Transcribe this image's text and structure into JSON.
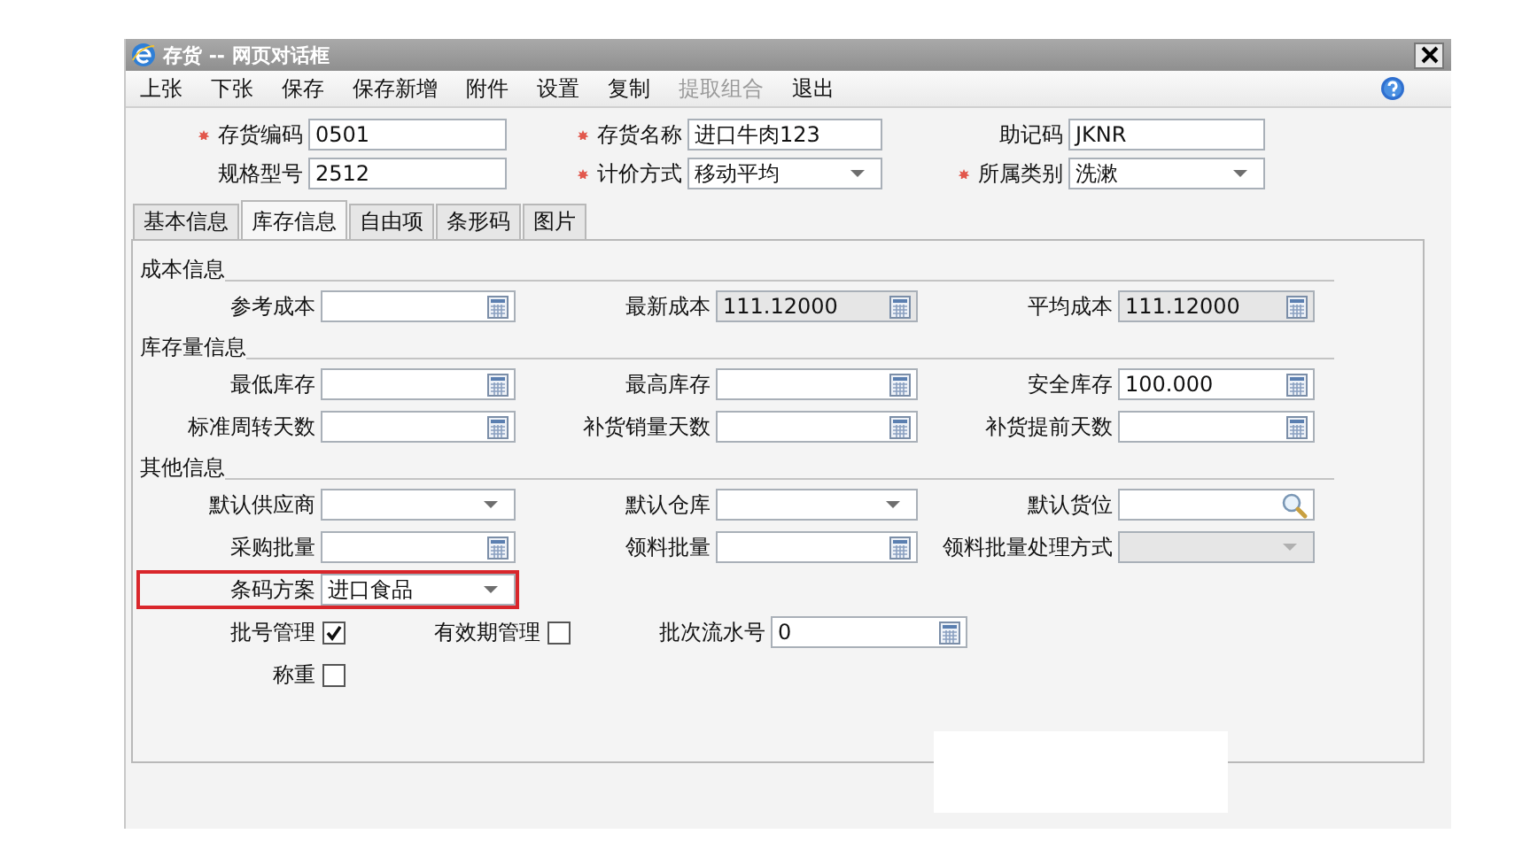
{
  "window": {
    "title": "存货 -- 网页对话框"
  },
  "toolbar": [
    {
      "label": "上张",
      "disabled": false
    },
    {
      "label": "下张",
      "disabled": false
    },
    {
      "label": "保存",
      "disabled": false
    },
    {
      "label": "保存新增",
      "disabled": false
    },
    {
      "label": "附件",
      "disabled": false
    },
    {
      "label": "设置",
      "disabled": false
    },
    {
      "label": "复制",
      "disabled": false
    },
    {
      "label": "提取组合",
      "disabled": true
    },
    {
      "label": "退出",
      "disabled": false
    }
  ],
  "header_rows": [
    {
      "fields": [
        {
          "label": "存货编码",
          "value": "0501",
          "required": true,
          "kind": "text"
        },
        {
          "label": "存货名称",
          "value": "进口牛肉123",
          "required": true,
          "kind": "text"
        },
        {
          "label": "助记码",
          "value": "JKNR",
          "required": false,
          "kind": "text"
        }
      ]
    },
    {
      "fields": [
        {
          "label": "规格型号",
          "value": "2512",
          "required": false,
          "kind": "text"
        },
        {
          "label": "计价方式",
          "value": "移动平均",
          "required": true,
          "kind": "select"
        },
        {
          "label": "所属类别",
          "value": "洗漱",
          "required": true,
          "kind": "select"
        }
      ]
    }
  ],
  "tabs": [
    {
      "label": "基本信息",
      "selected": false
    },
    {
      "label": "库存信息",
      "selected": true
    },
    {
      "label": "自由项",
      "selected": false
    },
    {
      "label": "条形码",
      "selected": false
    },
    {
      "label": "图片",
      "selected": false
    }
  ],
  "sections": [
    {
      "title": "成本信息",
      "rows": [
        {
          "fields": [
            {
              "label": "参考成本",
              "kind": "number",
              "disabled": false
            },
            {
              "label": "最新成本",
              "value": "111.12000",
              "kind": "number",
              "disabled": true
            },
            {
              "label": "平均成本",
              "value": "111.12000",
              "kind": "number",
              "disabled": true
            }
          ]
        }
      ]
    },
    {
      "title": "库存量信息",
      "rows": [
        {
          "fields": [
            {
              "label": "最低库存",
              "kind": "number",
              "disabled": false
            },
            {
              "label": "最高库存",
              "kind": "number",
              "disabled": false
            },
            {
              "label": "安全库存",
              "value": "100.000",
              "kind": "number",
              "disabled": false
            }
          ]
        },
        {
          "fields": [
            {
              "label": "标准周转天数",
              "kind": "number",
              "disabled": false
            },
            {
              "label": "补货销量天数",
              "kind": "number",
              "disabled": false
            },
            {
              "label": "补货提前天数",
              "kind": "number",
              "disabled": false
            }
          ]
        }
      ]
    },
    {
      "title": "其他信息",
      "rows": [
        {
          "fields": [
            {
              "label": "默认供应商",
              "kind": "select",
              "disabled": false
            },
            {
              "label": "默认仓库",
              "kind": "select",
              "disabled": false
            },
            {
              "label": "默认货位",
              "kind": "lookup",
              "disabled": false
            }
          ]
        },
        {
          "fields": [
            {
              "label": "采购批量",
              "kind": "number",
              "disabled": false
            },
            {
              "label": "领料批量",
              "kind": "number",
              "disabled": false
            },
            {
              "label": "领料批量处理方式",
              "kind": "select",
              "disabled": true
            }
          ]
        },
        {
          "fields": [
            {
              "label": "条码方案",
              "value": "进口食品",
              "kind": "select",
              "disabled": false,
              "highlighted": true
            }
          ]
        },
        {
          "fields": [
            {
              "label": "批号管理",
              "kind": "checkbox",
              "checked": true
            },
            {
              "label": "有效期管理",
              "kind": "checkbox",
              "checked": false
            },
            {
              "label": "批次流水号",
              "value": "0",
              "kind": "number",
              "disabled": false
            }
          ]
        },
        {
          "fields": [
            {
              "label": "称重",
              "kind": "checkbox",
              "checked": false
            }
          ]
        }
      ]
    }
  ]
}
